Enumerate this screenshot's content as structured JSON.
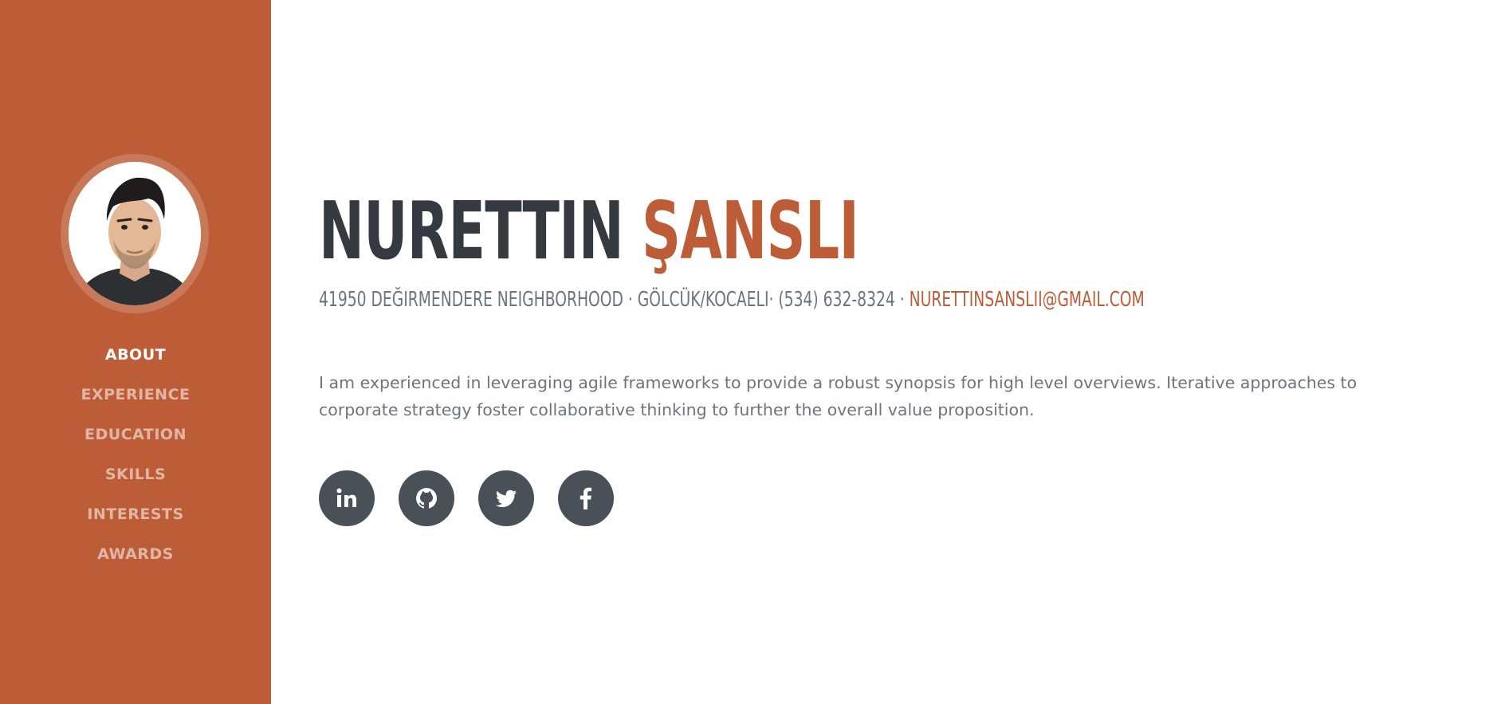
{
  "profile": {
    "first_name": "NURETTIN",
    "last_name": "ŞANSLI",
    "address": "41950 DEĞIRMENDERE NEIGHBORHOOD · GÖLCÜK/KOCAELI· (534) 632-8324 ·",
    "email": "NURETTINSANSLII@GMAIL.COM",
    "bio": "I am experienced in leveraging agile frameworks to provide a robust synopsis for high level overviews. Iterative approaches to corporate strategy foster collaborative thinking to further the overall value proposition."
  },
  "nav": {
    "items": [
      {
        "label": "ABOUT"
      },
      {
        "label": "EXPERIENCE"
      },
      {
        "label": "EDUCATION"
      },
      {
        "label": "SKILLS"
      },
      {
        "label": "INTERESTS"
      },
      {
        "label": "AWARDS"
      }
    ],
    "active": "ABOUT"
  },
  "social": {
    "icons": [
      "linkedin-icon",
      "github-icon",
      "twitter-icon",
      "facebook-icon"
    ]
  },
  "colors": {
    "sidebar": "#bd5d38",
    "accent": "#bd5d38",
    "heading": "#343a40",
    "text": "#6c757d",
    "social_button": "#495057"
  }
}
